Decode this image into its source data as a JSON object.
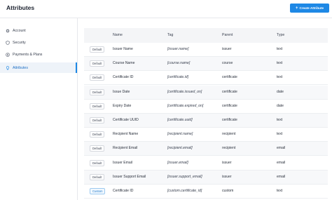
{
  "header": {
    "title": "Attributes",
    "create_button": "Create Attribute"
  },
  "sidebar": {
    "items": [
      {
        "label": "Account",
        "icon": "gear-icon",
        "active": false
      },
      {
        "label": "Security",
        "icon": "shield-icon",
        "active": false
      },
      {
        "label": "Payments & Plans",
        "icon": "dollar-icon",
        "active": false
      },
      {
        "label": "Attributes",
        "icon": "lightbulb-icon",
        "active": true
      }
    ]
  },
  "table": {
    "columns": [
      "Name",
      "Tag",
      "Parent",
      "Type"
    ],
    "rows": [
      {
        "badge": "Default",
        "name": "Issuer Name",
        "tag": "[issuer.name]",
        "parent": "issuer",
        "type": "text"
      },
      {
        "badge": "Default",
        "name": "Course Name",
        "tag": "[course.name]",
        "parent": "course",
        "type": "text"
      },
      {
        "badge": "Default",
        "name": "Certificate ID",
        "tag": "[certificate.id]",
        "parent": "certificate",
        "type": "text"
      },
      {
        "badge": "Default",
        "name": "Issue Date",
        "tag": "[certificate.issued_on]",
        "parent": "certificate",
        "type": "date"
      },
      {
        "badge": "Default",
        "name": "Expiry Date",
        "tag": "[certificate.expired_on]",
        "parent": "certificate",
        "type": "date"
      },
      {
        "badge": "Default",
        "name": "Certificate UUID",
        "tag": "[certificate.uuid]",
        "parent": "certificate",
        "type": "text"
      },
      {
        "badge": "Default",
        "name": "Recipient Name",
        "tag": "[recipient.name]",
        "parent": "recipient",
        "type": "text"
      },
      {
        "badge": "Default",
        "name": "Recipient Email",
        "tag": "[recipient.email]",
        "parent": "recipient",
        "type": "email"
      },
      {
        "badge": "Default",
        "name": "Issuer Email",
        "tag": "[issuer.email]",
        "parent": "issuer",
        "type": "email"
      },
      {
        "badge": "Default",
        "name": "Issuer Support Email",
        "tag": "[issuer.support_email]",
        "parent": "issuer",
        "type": "email"
      },
      {
        "badge": "Custom",
        "name": "Certificate ID",
        "tag": "[custom.certificate_id]",
        "parent": "custom",
        "type": "text"
      }
    ]
  },
  "colors": {
    "accent": "#1e88e5",
    "active_bg": "#eef3f9",
    "header_bg": "#f4f5f7"
  }
}
